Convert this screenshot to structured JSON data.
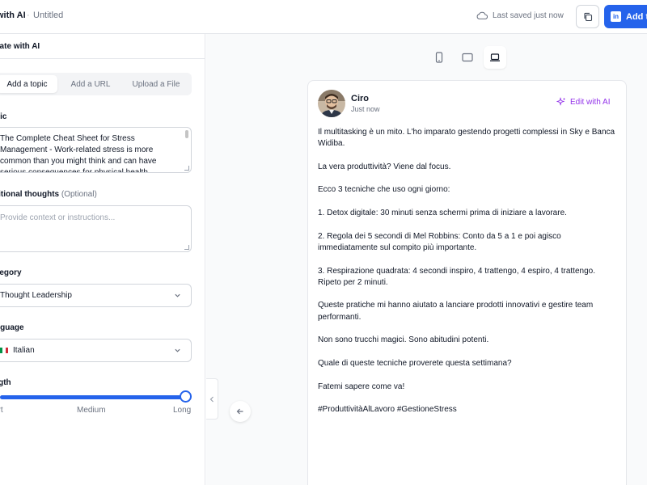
{
  "header": {
    "app_title": "with AI",
    "separator": "·",
    "doc_title": "Untitled",
    "saved_status": "Last saved just now",
    "add_button_label": "Add t",
    "icons": {
      "cloud": "cloud-icon",
      "copy": "copy-icon",
      "linkedin": "linkedin-icon"
    }
  },
  "sidebar": {
    "title": "eate with AI",
    "tabs": [
      {
        "label": "Add a topic",
        "active": true
      },
      {
        "label": "Add a URL",
        "active": false
      },
      {
        "label": "Upload a File",
        "active": false
      }
    ],
    "topic": {
      "label": "pic",
      "value": "The Complete Cheat Sheet for Stress Management - Work-related stress is more common than you might think and can have serious consequences for physical health"
    },
    "thoughts": {
      "label": "ditional thoughts",
      "optional": "(Optional)",
      "placeholder": "Provide context or instructions..."
    },
    "category": {
      "label": "tegory",
      "value": "Thought Leadership"
    },
    "language": {
      "label": "nguage",
      "value": "Italian",
      "flag_colors": [
        "#009246",
        "#ffffff",
        "#ce2b37"
      ]
    },
    "length": {
      "label": "ngth",
      "min_label": "ort",
      "mid_label": "Medium",
      "max_label": "Long",
      "level": 1.0
    }
  },
  "preview": {
    "devices": [
      {
        "name": "mobile",
        "active": false
      },
      {
        "name": "tablet",
        "active": false
      },
      {
        "name": "desktop",
        "active": true
      }
    ],
    "post": {
      "author": "Ciro",
      "time": "Just now",
      "edit_label": "Edit with AI",
      "paragraphs": [
        "Il multitasking è un mito. L'ho imparato gestendo progetti complessi in Sky e Banca Widiba.",
        "La vera produttività? Viene dal focus.",
        "Ecco 3 tecniche che uso ogni giorno:",
        "1. Detox digitale: 30 minuti senza schermi prima di iniziare a lavorare.",
        "2. Regola dei 5 secondi di Mel Robbins: Conto da 5 a 1 e poi agisco immediatamente sul compito più importante.",
        "3. Respirazione quadrata: 4 secondi inspiro, 4 trattengo, 4 espiro, 4 trattengo. Ripeto per 2 minuti.",
        "Queste pratiche mi hanno aiutato a lanciare prodotti innovativi e gestire team performanti.",
        "Non sono trucchi magici. Sono abitudini potenti.",
        "Quale di queste tecniche proverete questa settimana?",
        "Fatemi sapere come va!",
        "#ProduttivitàAlLavoro #GestioneStress"
      ]
    }
  },
  "colors": {
    "accent": "#2563eb",
    "ai_purple": "#9333ea",
    "border": "#e5e7eb",
    "muted": "#6b7280"
  }
}
